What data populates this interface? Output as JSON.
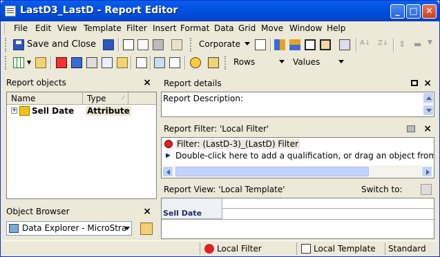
{
  "window": {
    "title": "LastD3_LastD  -  Report Editor"
  },
  "title_buttons": {
    "minimize": "_",
    "maximize": "□",
    "close": "✕"
  },
  "menu": [
    "File",
    "Edit",
    "View",
    "Template",
    "Filter",
    "Insert",
    "Format",
    "Data",
    "Grid",
    "Move",
    "Window",
    "Help"
  ],
  "toolbar1": {
    "save_close_label": "Save and Close",
    "template_combo": "Corporate"
  },
  "toolbar2": {
    "rows_combo": "Rows",
    "values_combo": "Values"
  },
  "report_objects": {
    "title": "Report objects",
    "col_name": "Name",
    "col_type": "Type",
    "rows": [
      {
        "name": "Sell Date",
        "type": "Attribute"
      }
    ]
  },
  "object_browser": {
    "title": "Object Browser",
    "combo": "Data Explorer - MicroStra"
  },
  "report_details": {
    "title": "Report details",
    "description_label": "Report Description:"
  },
  "report_filter": {
    "title": "Report Filter: 'Local Filter'",
    "filter_line": "Filter: (LastD-3)_(LastD) Filter",
    "hint": "Double-click here to add a qualification, or drag an object from the"
  },
  "report_view": {
    "title": "Report View: 'Local Template'",
    "switch_label": "Switch to:",
    "grid_header": "Sell Date"
  },
  "status": {
    "filter": "Local Filter",
    "template": "Local Template",
    "mode": "Standard"
  }
}
